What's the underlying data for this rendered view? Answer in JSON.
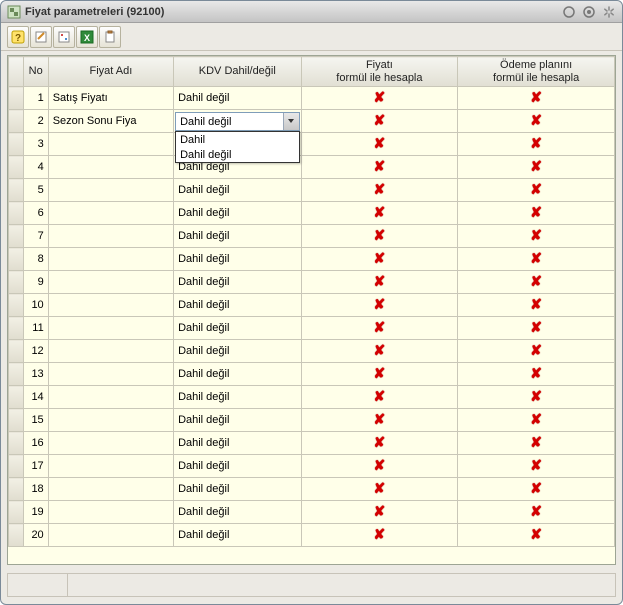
{
  "window": {
    "title": "Fiyat parametreleri (92100)"
  },
  "columns": {
    "no": "No",
    "name": "Fiyat Adı",
    "kdv": "KDV Dahil/değil",
    "col4_l1": "Fiyatı",
    "col4_l2": "formül ile hesapla",
    "col5_l1": "Ödeme planını",
    "col5_l2": "formül ile hesapla"
  },
  "combo": {
    "value": "Dahil değil",
    "options": [
      "Dahil",
      "Dahil değil"
    ]
  },
  "rows": [
    {
      "no": "1",
      "name": "Satış Fiyatı",
      "kdv": "Dahil değil",
      "editing": false
    },
    {
      "no": "2",
      "name": "Sezon Sonu Fiya",
      "kdv": "Dahil değil",
      "editing": true
    },
    {
      "no": "3",
      "name": "",
      "kdv": "",
      "editing": false
    },
    {
      "no": "4",
      "name": "",
      "kdv": "Dahil değil",
      "editing": false
    },
    {
      "no": "5",
      "name": "",
      "kdv": "Dahil değil",
      "editing": false
    },
    {
      "no": "6",
      "name": "",
      "kdv": "Dahil değil",
      "editing": false
    },
    {
      "no": "7",
      "name": "",
      "kdv": "Dahil değil",
      "editing": false
    },
    {
      "no": "8",
      "name": "",
      "kdv": "Dahil değil",
      "editing": false
    },
    {
      "no": "9",
      "name": "",
      "kdv": "Dahil değil",
      "editing": false
    },
    {
      "no": "10",
      "name": "",
      "kdv": "Dahil değil",
      "editing": false
    },
    {
      "no": "11",
      "name": "",
      "kdv": "Dahil değil",
      "editing": false
    },
    {
      "no": "12",
      "name": "",
      "kdv": "Dahil değil",
      "editing": false
    },
    {
      "no": "13",
      "name": "",
      "kdv": "Dahil değil",
      "editing": false
    },
    {
      "no": "14",
      "name": "",
      "kdv": "Dahil değil",
      "editing": false
    },
    {
      "no": "15",
      "name": "",
      "kdv": "Dahil değil",
      "editing": false
    },
    {
      "no": "16",
      "name": "",
      "kdv": "Dahil değil",
      "editing": false
    },
    {
      "no": "17",
      "name": "",
      "kdv": "Dahil değil",
      "editing": false
    },
    {
      "no": "18",
      "name": "",
      "kdv": "Dahil değil",
      "editing": false
    },
    {
      "no": "19",
      "name": "",
      "kdv": "Dahil değil",
      "editing": false
    },
    {
      "no": "20",
      "name": "",
      "kdv": "Dahil değil",
      "editing": false
    }
  ]
}
